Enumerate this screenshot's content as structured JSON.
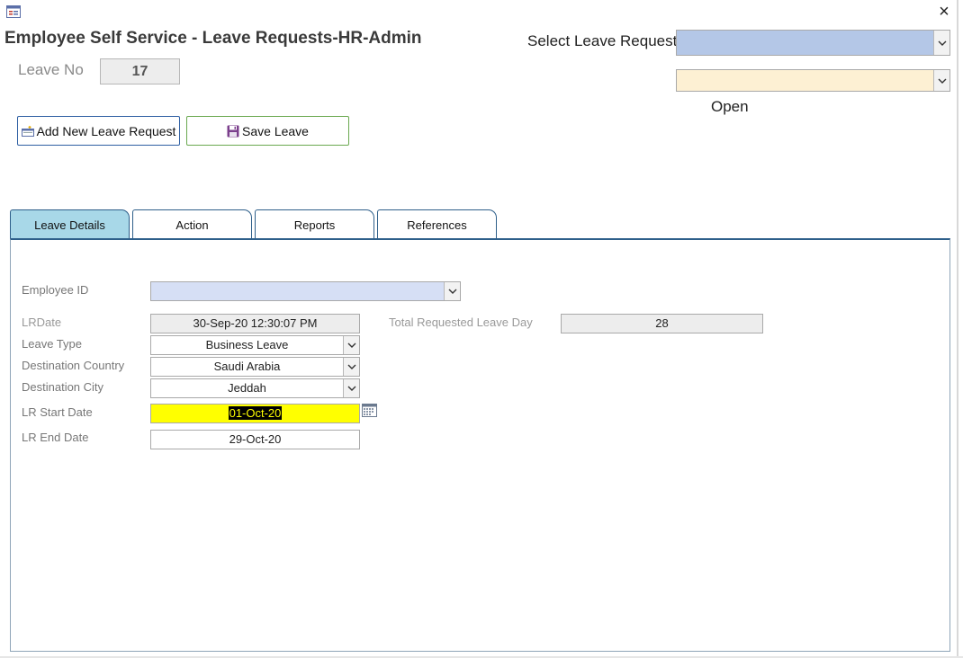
{
  "window": {
    "title": "Employee Self Service - Leave Requests-HR-Admin",
    "close_glyph": "×",
    "form_icon": "form-icon",
    "close_icon": "close-icon"
  },
  "header": {
    "leave_no_label": "Leave No",
    "leave_no_value": "17",
    "select_label": "Select Leave Request",
    "select_value": "",
    "status_combo_value": "",
    "status_text": "Open"
  },
  "toolbar": {
    "add_label": "Add New Leave Request",
    "save_label": "Save Leave",
    "add_icon": "add-record-icon",
    "save_icon": "floppy-disk-icon"
  },
  "tabs": [
    {
      "label": "Leave Details",
      "active": true
    },
    {
      "label": "Action",
      "active": false
    },
    {
      "label": "Reports",
      "active": false
    },
    {
      "label": "References",
      "active": false
    }
  ],
  "form": {
    "employee_id": {
      "label": "Employee ID",
      "value": ""
    },
    "lr_date": {
      "label": "LRDate",
      "value": "30-Sep-20 12:30:07 PM"
    },
    "total_days": {
      "label": "Total Requested Leave Day",
      "value": "28"
    },
    "leave_type": {
      "label": "Leave Type",
      "value": "Business Leave"
    },
    "dest_country": {
      "label": "Destination Country",
      "value": "Saudi Arabia"
    },
    "dest_city": {
      "label": "Destination City",
      "value": "Jeddah"
    },
    "start_date": {
      "label": "LR Start Date",
      "value": "01-Oct-20"
    },
    "end_date": {
      "label": "LR End Date",
      "value": "29-Oct-20"
    }
  },
  "colors": {
    "select_combo_bg": "#b4c7e7",
    "status_combo_bg": "#fdf0d3",
    "employee_combo_bg": "#d6dff5",
    "active_tab_bg": "#a8d8e8",
    "highlight_field_bg": "#ffff00"
  }
}
